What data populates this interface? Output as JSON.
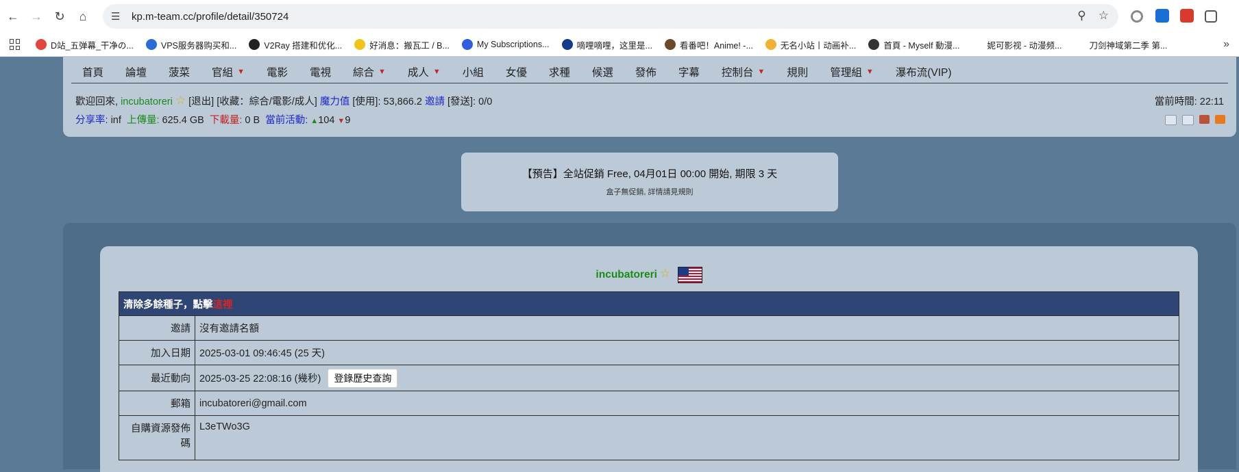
{
  "browser": {
    "url": "kp.m-team.cc/profile/detail/350724",
    "bookmarks": [
      {
        "label": "D站_五弹幕_干净の...",
        "color": "#e2453c"
      },
      {
        "label": "VPS服务器购买和...",
        "color": "#2b6bd6"
      },
      {
        "label": "V2Ray 搭建和优化...",
        "color": "#222222"
      },
      {
        "label": "好消息：搬瓦工 / B...",
        "color": "#f0c419"
      },
      {
        "label": "My Subscriptions...",
        "color": "#2f5fe0"
      },
      {
        "label": "嘀哩嘀哩，这里是...",
        "color": "#123a8a"
      },
      {
        "label": "看番吧！Anime! -...",
        "color": "#6b4a2a"
      },
      {
        "label": "无名小站丨动画补...",
        "color": "#f2b134"
      },
      {
        "label": "首頁 - Myself 動漫...",
        "color": "#333333"
      },
      {
        "label": "妮可影视 - 动漫频...",
        "color": "#ffffff"
      },
      {
        "label": "刀剑神域第二季 第...",
        "color": "#ffffff"
      }
    ]
  },
  "nav": {
    "items": [
      {
        "label": "首頁",
        "dropdown": false
      },
      {
        "label": "論壇",
        "dropdown": false
      },
      {
        "label": "菠菜",
        "dropdown": false
      },
      {
        "label": "官組",
        "dropdown": true
      },
      {
        "label": "電影",
        "dropdown": false
      },
      {
        "label": "電視",
        "dropdown": false
      },
      {
        "label": "綜合",
        "dropdown": true
      },
      {
        "label": "成人",
        "dropdown": true
      },
      {
        "label": "小組",
        "dropdown": false
      },
      {
        "label": "女優",
        "dropdown": false
      },
      {
        "label": "求種",
        "dropdown": false
      },
      {
        "label": "候選",
        "dropdown": false
      },
      {
        "label": "發佈",
        "dropdown": false
      },
      {
        "label": "字幕",
        "dropdown": false
      },
      {
        "label": "控制台",
        "dropdown": true
      },
      {
        "label": "規則",
        "dropdown": false
      },
      {
        "label": "管理組",
        "dropdown": true
      },
      {
        "label": "瀑布流(VIP)",
        "dropdown": false
      }
    ]
  },
  "userbar": {
    "welcome": "歡迎回來,",
    "username": "incubatoreri",
    "logout": "[退出]",
    "favorites": "[收藏：綜合/電影/成人]",
    "magic": "魔力值",
    "use_text": "[使用]: 53,866.2",
    "invite": "邀請",
    "send_text": "[發送]: 0/0",
    "time_label": "當前時間:",
    "time_value": "22:11",
    "ratio_label": "分享率:",
    "ratio_value": "inf",
    "upload_label": "上傳量:",
    "upload_value": "625.4 GB",
    "download_label": "下載量:",
    "download_value": "0 B",
    "activity_label": "當前活動:",
    "seeding": "104",
    "leeching": "9"
  },
  "notice": {
    "line1": "【預告】全站促銷 Free, 04月01日 00:00 開始, 期限 3 天",
    "line2": "盒子無促銷, 詳情請見規則"
  },
  "profile": {
    "username": "incubatoreri",
    "banner_text": "清除多餘種子，點擊",
    "banner_link": "這裡",
    "rows": [
      {
        "key": "邀請",
        "value": "沒有邀請名額"
      },
      {
        "key": "加入日期",
        "value": "2025-03-01 09:46:45 (25 天)"
      },
      {
        "key": "最近動向",
        "value": "2025-03-25 22:08:16 (幾秒)",
        "button": "登錄歷史查詢"
      },
      {
        "key": "郵箱",
        "value": "incubatoreri@gmail.com"
      },
      {
        "key": "自購資源發佈碼",
        "value": "L3eTWo3G"
      }
    ]
  }
}
